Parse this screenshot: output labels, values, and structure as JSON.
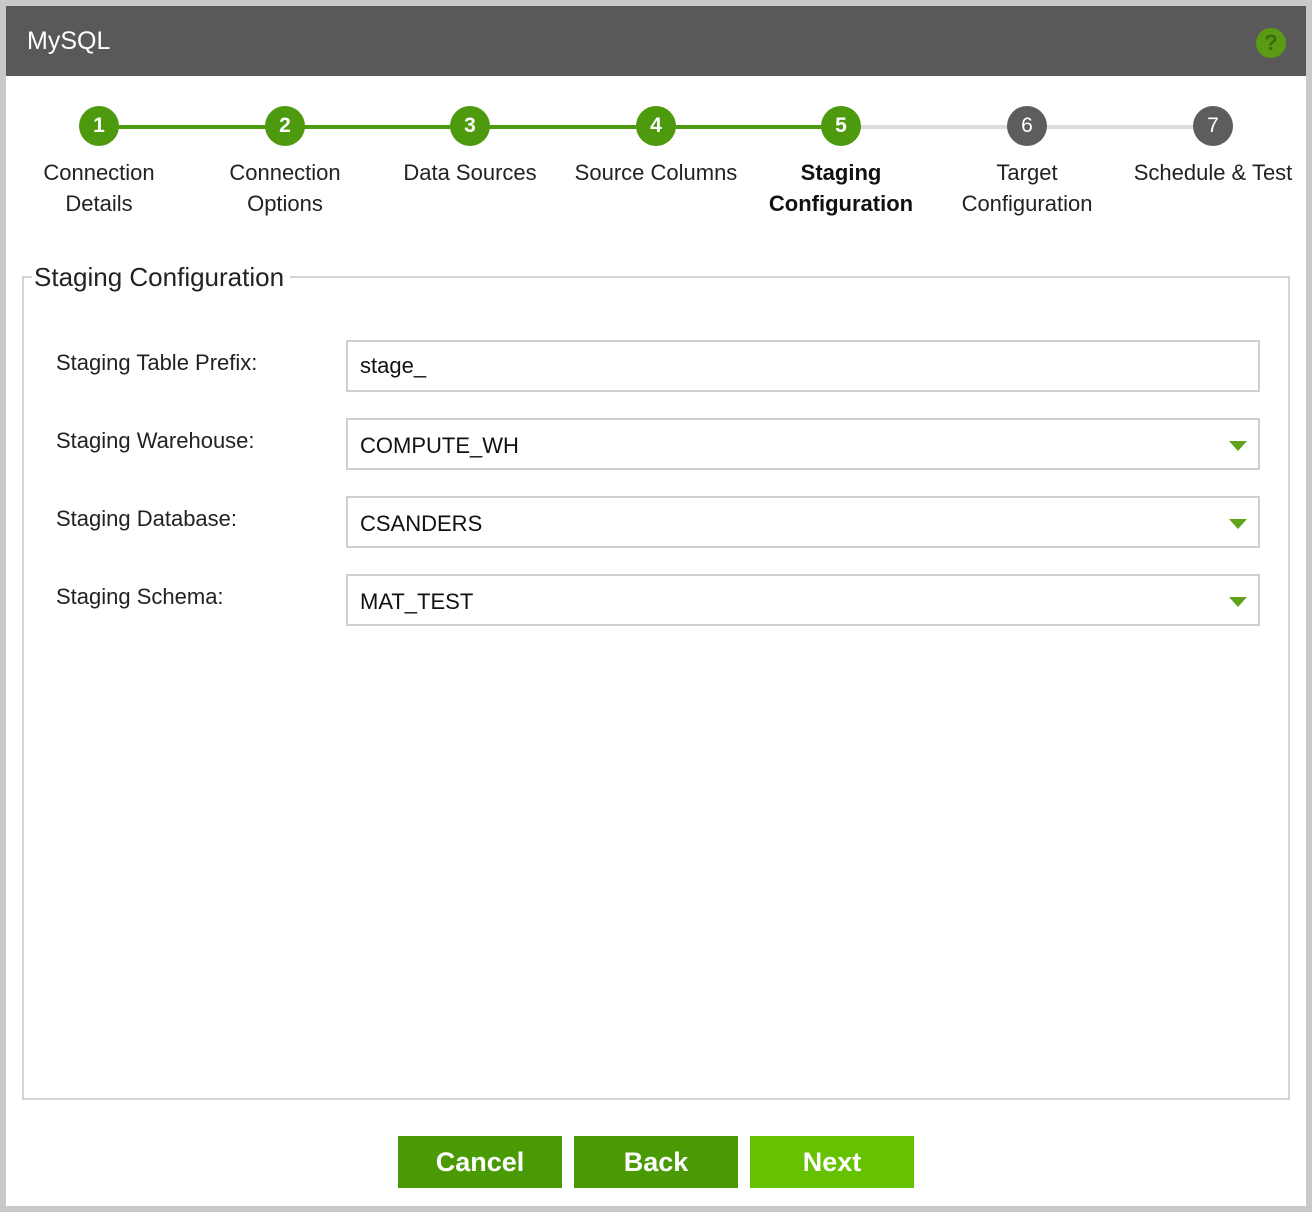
{
  "window": {
    "title": "MySQL"
  },
  "wizard": {
    "steps": [
      {
        "number": "1",
        "label_line1": "Connection",
        "label_line2": "Details"
      },
      {
        "number": "2",
        "label_line1": "Connection",
        "label_line2": "Options"
      },
      {
        "number": "3",
        "label_line1": "Data Sources",
        "label_line2": ""
      },
      {
        "number": "4",
        "label_line1": "Source Columns",
        "label_line2": ""
      },
      {
        "number": "5",
        "label_line1": "Staging",
        "label_line2": "Configuration"
      },
      {
        "number": "6",
        "label_line1": "Target",
        "label_line2": "Configuration"
      },
      {
        "number": "7",
        "label_line1": "Schedule & Test",
        "label_line2": ""
      }
    ],
    "active_step": 5
  },
  "panel": {
    "title": "Staging Configuration",
    "fields": [
      {
        "label": "Staging Table Prefix:",
        "value": "stage_"
      },
      {
        "label": "Staging Warehouse:",
        "value": "COMPUTE_WH"
      },
      {
        "label": "Staging Database:",
        "value": "CSANDERS"
      },
      {
        "label": "Staging Schema:",
        "value": "MAT_TEST"
      }
    ]
  },
  "footer": {
    "cancel_label": "Cancel",
    "back_label": "Back",
    "next_label": "Next"
  },
  "colors": {
    "titlebar": "#595959",
    "step_done": "#4d9a0e",
    "step_todo": "#5d5d5d",
    "button_dark": "#4a9a06",
    "button_bright": "#66c200"
  }
}
